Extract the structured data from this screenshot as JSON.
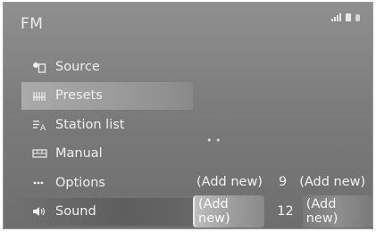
{
  "header": {
    "title": "FM"
  },
  "menu": {
    "items": [
      {
        "label": "Source",
        "icon": "source-icon"
      },
      {
        "label": "Presets",
        "icon": "presets-icon"
      },
      {
        "label": "Station list",
        "icon": "station-list-icon"
      },
      {
        "label": "Manual",
        "icon": "manual-icon"
      },
      {
        "label": "Options",
        "icon": "options-icon"
      },
      {
        "label": "Sound",
        "icon": "sound-icon"
      }
    ]
  },
  "presets": {
    "row1": {
      "left": "(Add new)",
      "number": "9",
      "right": "(Add new)"
    },
    "row2": {
      "left": "(Add new)",
      "number": "12",
      "right": "(Add new)"
    }
  },
  "colors": {
    "background": "#7c7c7c",
    "selected": "#a5a5a5",
    "text": "#efefef"
  }
}
